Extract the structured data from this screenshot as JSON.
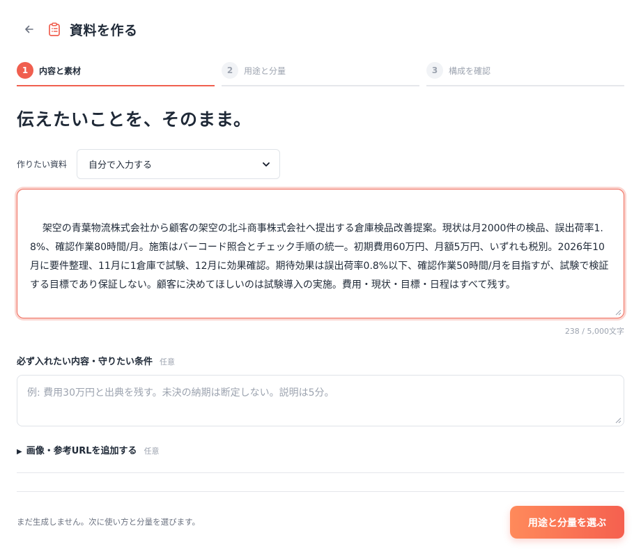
{
  "header": {
    "back_icon": "arrow-left-icon",
    "doc_icon": "clipboard-list-icon",
    "title": "資料を作る"
  },
  "steps": [
    {
      "number": "1",
      "label": "内容と素材",
      "active": true
    },
    {
      "number": "2",
      "label": "用途と分量",
      "active": false
    },
    {
      "number": "3",
      "label": "構成を確認",
      "active": false
    }
  ],
  "headline": "伝えたいことを、そのまま。",
  "doc_type": {
    "label": "作りたい資料",
    "selected": "自分で入力する"
  },
  "content": {
    "value": "架空の青葉物流株式会社から顧客の架空の北斗商事株式会社へ提出する倉庫検品改善提案。現状は月2000件の検品、誤出荷率1.8%、確認作業80時間/月。施策はバーコード照合とチェック手順の統一。初期費用60万円、月額5万円、いずれも税別。2026年10月に要件整理、11月に1倉庫で試験、12月に効果確認。期待効果は誤出荷率0.8%以下、確認作業50時間/月を目指すが、試験で検証する目標であり保証しない。顧客に決めてほしいのは試験導入の実施。費用・現状・目標・日程はすべて残す。",
    "counter": "238 / 5,000文字"
  },
  "conditions": {
    "label": "必ず入れたい内容・守りたい条件",
    "optional": "任意",
    "placeholder": "例: 費用30万円と出典を残す。未決の納期は断定しない。説明は5分。"
  },
  "attachments": {
    "label": "画像・参考URLを追加する",
    "optional": "任意"
  },
  "footer": {
    "note": "まだ生成しません。次に使い方と分量を選びます。",
    "primary_button": "用途と分量を選ぶ"
  },
  "colors": {
    "accent": "#f05f4f",
    "accent_gradient_start": "#ff8a5b",
    "border": "#dfe3e8",
    "muted_text": "#9ca3af"
  }
}
